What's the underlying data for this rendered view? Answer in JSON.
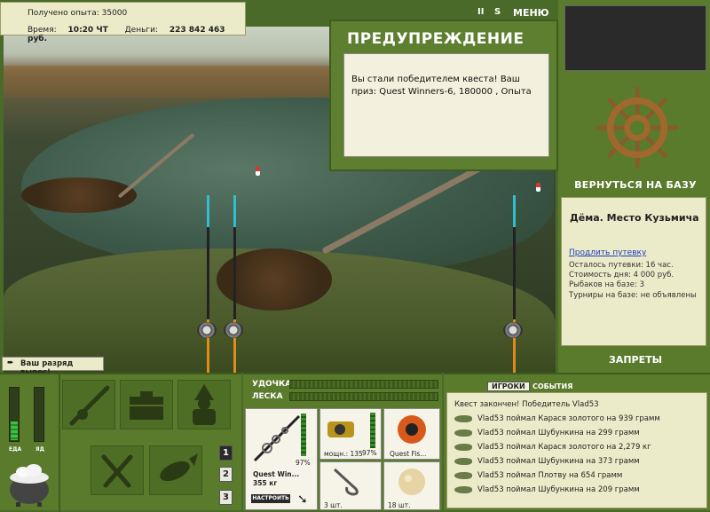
{
  "info": {
    "exp_label": "Получено опыта:",
    "exp_value": "35000",
    "time_label": "Время:",
    "time_value": "10:20 ЧТ",
    "money_label": "Деньги:",
    "money_value": "223 842 463 руб."
  },
  "top_menu": {
    "pause": "II",
    "sound": "S",
    "menu": "МЕНЮ"
  },
  "warning": {
    "title": "ПРЕДУПРЕЖДЕНИЕ",
    "message": "Вы стали победителем квеста! Ваш приз: Quest Winners-6, 180000 , Опыта"
  },
  "right": {
    "back_to_base": "ВЕРНУТЬСЯ НА БАЗУ",
    "base_name": "Дёма. Место Кузьмича",
    "extend": "Продлить путевку",
    "lines": [
      "Осталось путевки: 16 час.",
      "Стоимость дня: 4 000 руб.",
      "Рыбаков на базе: 3",
      "Турниры на базе: не объявлены"
    ],
    "bans": "ЗАПРЕТЫ"
  },
  "rank": "Ваш разряд вырос!",
  "meters": {
    "food": "ЕДА",
    "poison": "ЯД",
    "food_level": 0.35,
    "poison_level": 0.0
  },
  "page_buttons": [
    "1",
    "2",
    "3"
  ],
  "tackle": {
    "rod_label": "УДОЧКА",
    "line_label": "ЛЕСКА",
    "rod_name": "Quest Win...",
    "rod_weight": "355 кг",
    "rod_pct": "97%",
    "reel_label": "мощн.: 135",
    "reel_pct": "97%",
    "line_name": "Quest Fis...",
    "hook_count": "3 шт.",
    "bait_count": "18 шт.",
    "setup_button": "НАСТРОИТЬ"
  },
  "log": {
    "tab_players": "ИГРОКИ",
    "tab_events": "СОБЫТИЯ",
    "header": "Квест закончен! Победитель Vlad53",
    "entries": [
      "Vlad53 поймал Карася золотого на 939 грамм",
      "Vlad53 поймал Шубункина на 299 грамм",
      "Vlad53 поймал Карася золотого на 2,279 кг",
      "Vlad53 поймал Шубункина на 373 грамм",
      "Vlad53 поймал Плотву на 654 грамм",
      "Vlad53 поймал Шубункина на 209 грамм"
    ]
  }
}
